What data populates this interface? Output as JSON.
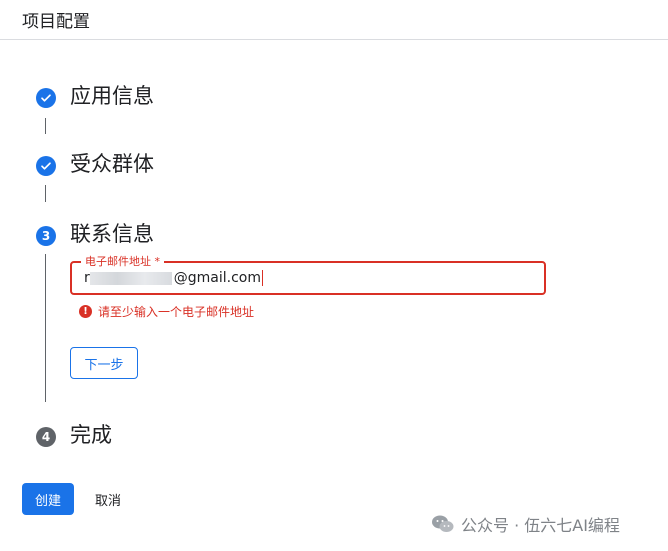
{
  "header": {
    "title": "项目配置"
  },
  "steps": [
    {
      "number": "",
      "title": "应用信息",
      "status": "done"
    },
    {
      "number": "",
      "title": "受众群体",
      "status": "done"
    },
    {
      "number": "3",
      "title": "联系信息",
      "status": "active"
    },
    {
      "number": "4",
      "title": "完成",
      "status": "pending"
    }
  ],
  "contact_form": {
    "email_label": "电子邮件地址 *",
    "email_value_suffix": "@gmail.com",
    "email_value_prefix": "r",
    "error_message": "请至少输入一个电子邮件地址",
    "error_icon": "!",
    "next_label": "下一步"
  },
  "footer": {
    "create_label": "创建",
    "cancel_label": "取消"
  },
  "watermark": {
    "text": "公众号 · 伍六七AI编程",
    "icon": "wechat-icon"
  },
  "colors": {
    "accent": "#1a73e8",
    "error": "#d93025",
    "pending": "#5f6368"
  }
}
